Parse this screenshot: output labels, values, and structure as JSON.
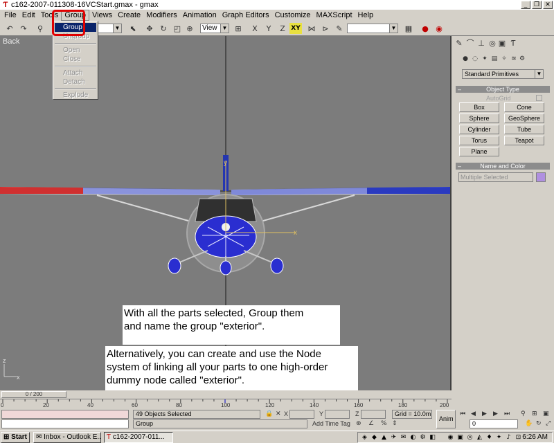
{
  "window": {
    "title": "c162-2007-011308-16VCStart.gmax - gmax",
    "minimize": "_",
    "restore": "❐",
    "close": "✕"
  },
  "menubar": [
    "File",
    "Edit",
    "Tools",
    "Group",
    "Views",
    "Create",
    "Modifiers",
    "Animation",
    "Graph Editors",
    "Customize",
    "MAXScript",
    "Help"
  ],
  "toolbar": {
    "view_dropdown": "View",
    "axis_xy": "XY"
  },
  "group_menu": {
    "items": [
      "Group",
      "Ungroup",
      "Open",
      "Close",
      "Attach",
      "Detach",
      "Explode"
    ],
    "selected": "Group"
  },
  "viewport": {
    "label": "Back",
    "axis_x": "x",
    "axis_y": "y",
    "axis_z": "z"
  },
  "notes": {
    "note1": [
      "With all the parts selected, Group them",
      "and name the group \"exterior\"."
    ],
    "note2": [
      "Alternatively, you can create and use the Node",
      "system of linking all your parts to one high-order",
      "dummy node called \"exterior\"."
    ]
  },
  "command_panel": {
    "category": "Standard Primitives",
    "object_type_title": "Object Type",
    "autogrid": "AutoGrid",
    "buttons": [
      "Box",
      "Cone",
      "Sphere",
      "GeoSphere",
      "Cylinder",
      "Tube",
      "Torus",
      "Teapot",
      "Plane"
    ],
    "name_color_title": "Name and Color",
    "name_value": "Multiple Selected",
    "selection_color": "#b090e0"
  },
  "timeline": {
    "frame_display": "0 / 200",
    "tick_labels": [
      "0",
      "20",
      "40",
      "60",
      "80",
      "100",
      "120",
      "140",
      "160",
      "180",
      "200"
    ]
  },
  "status": {
    "selection": "49 Objects Selected",
    "prompt": "Group",
    "x_label": "X",
    "y_label": "Y",
    "z_label": "Z",
    "grid": "Grid = 10.0m",
    "add_time_tag": "Add Time Tag",
    "anim": "Anim",
    "frame_value": "0"
  },
  "taskbar": {
    "start": "Start",
    "tasks": [
      "Inbox - Outlook E...",
      "c162-2007-011..."
    ],
    "clock": "6:26 AM"
  }
}
